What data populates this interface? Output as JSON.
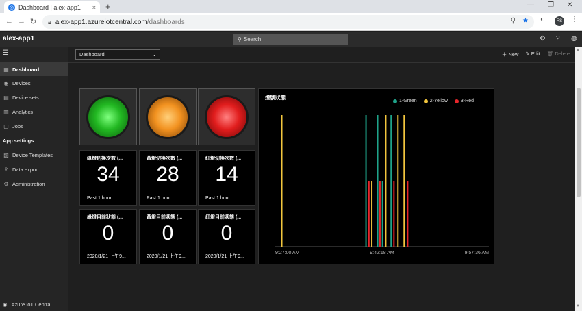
{
  "browser": {
    "tab_title": "Dashboard | alex-app1",
    "tab_close": "×",
    "new_tab": "+",
    "url_host": "alex-app1.azureiotcentral.com",
    "url_path": "/dashboards",
    "avatar_initials": "RS",
    "win_min": "—",
    "win_max": "❐",
    "win_close": "✕"
  },
  "app": {
    "name": "alex-app1",
    "search_placeholder": "Search"
  },
  "sidebar": {
    "items": [
      {
        "label": "Dashboard",
        "icon": "dashboard-icon",
        "glyph": "▦"
      },
      {
        "label": "Devices",
        "icon": "devices-icon",
        "glyph": "◉"
      },
      {
        "label": "Device sets",
        "icon": "device-sets-icon",
        "glyph": "▤"
      },
      {
        "label": "Analytics",
        "icon": "analytics-icon",
        "glyph": "▥"
      },
      {
        "label": "Jobs",
        "icon": "jobs-icon",
        "glyph": "▢"
      }
    ],
    "section": "App settings",
    "settings": [
      {
        "label": "Device Templates",
        "icon": "templates-icon",
        "glyph": "▧"
      },
      {
        "label": "Data export",
        "icon": "export-icon",
        "glyph": "⇪"
      },
      {
        "label": "Administration",
        "icon": "admin-icon",
        "glyph": "⚙"
      }
    ],
    "footer": "Azure IoT Central"
  },
  "main": {
    "dashboard_select": "Dashboard",
    "actions": {
      "new": "New",
      "edit": "Edit",
      "delete": "Delete"
    }
  },
  "kpis_count": [
    {
      "title": "綠燈切換次數 (...",
      "value": "34",
      "sub": "Past 1 hour"
    },
    {
      "title": "黃燈切換次數 (...",
      "value": "28",
      "sub": "Past 1 hour"
    },
    {
      "title": "紅燈切換次數 (...",
      "value": "14",
      "sub": "Past 1 hour"
    }
  ],
  "kpis_state": [
    {
      "title": "綠燈目前狀態 (...",
      "value": "0",
      "sub": "2020/1/21 上午9..."
    },
    {
      "title": "黃燈目前狀態 (...",
      "value": "0",
      "sub": "2020/1/21 上午9..."
    },
    {
      "title": "紅燈目前狀態 (...",
      "value": "0",
      "sub": "2020/1/21 上午9..."
    }
  ],
  "colors": {
    "green": "#1fa38a",
    "yellow": "#f2c53d",
    "red": "#e8262b"
  },
  "chart_data": {
    "type": "bar",
    "title": "燈號狀態",
    "x_ticks": [
      "9:27:00 AM",
      "9:42:18 AM",
      "9:57:36 AM"
    ],
    "x_tick_positions_seconds": [
      0,
      918,
      1836
    ],
    "x_range_seconds": [
      0,
      1836
    ],
    "y_range": [
      0,
      1
    ],
    "series": [
      {
        "name": "1-Green",
        "color": "#1fa38a",
        "points": [
          [
            56,
            0.5
          ],
          [
            780,
            1
          ],
          [
            880,
            1
          ],
          [
            922,
            0.5
          ],
          [
            996,
            1
          ]
        ]
      },
      {
        "name": "2-Yellow",
        "color": "#f2c53d",
        "points": [
          [
            56,
            1
          ],
          [
            830,
            0.5
          ],
          [
            950,
            1
          ],
          [
            1055,
            1
          ],
          [
            1108,
            1
          ]
        ]
      },
      {
        "name": "3-Red",
        "color": "#e8262b",
        "points": [
          [
            805,
            0.5
          ],
          [
            900,
            0.5
          ],
          [
            1020,
            0.5
          ],
          [
            1138,
            0.5
          ]
        ]
      }
    ]
  }
}
